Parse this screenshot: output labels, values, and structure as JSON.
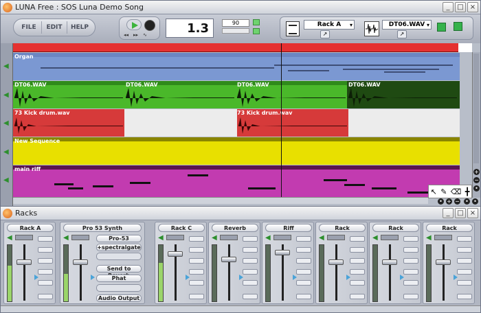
{
  "main_window": {
    "title": "LUNA Free : SOS Luna Demo Song",
    "menu": [
      "FILE",
      "EDIT",
      "HELP"
    ],
    "position": "1.3",
    "tempo": "90",
    "rack_select": "Rack A",
    "wave_select": "DT06.WAV",
    "window_buttons": [
      "_",
      "□",
      "×"
    ]
  },
  "tracks": [
    {
      "name": "Organ",
      "clips": [],
      "color": "#7090c8"
    },
    {
      "name": "DT06.WAV",
      "clips": [
        "DT06.WAV",
        "DT06.WAV",
        "DT06.WAV",
        "DT06.WAV"
      ],
      "color": "#4ab82a"
    },
    {
      "name": "73 Kick drum.wav",
      "clips": [
        "73 Kick drum.wav",
        "73 Kick drum.wav"
      ],
      "color": "#d63a3a"
    },
    {
      "name": "New Sequence",
      "clips": [],
      "color": "#e8e000"
    },
    {
      "name": "main riff",
      "clips": [],
      "color": "#c23bb0"
    }
  ],
  "racks_window": {
    "title": "Racks",
    "window_buttons": [
      "_",
      "□",
      "×"
    ],
    "strips": [
      "Rack A",
      "Rack C",
      "Reverb",
      "Riff",
      "Rack",
      "Rack",
      "Rack"
    ],
    "synth": {
      "name": "Pro 53 Synth",
      "plugins": [
        "Pro-53",
        "+spectralgate",
        "",
        "Send to Reverb",
        "Phat",
        "",
        "Audio Output"
      ]
    }
  }
}
